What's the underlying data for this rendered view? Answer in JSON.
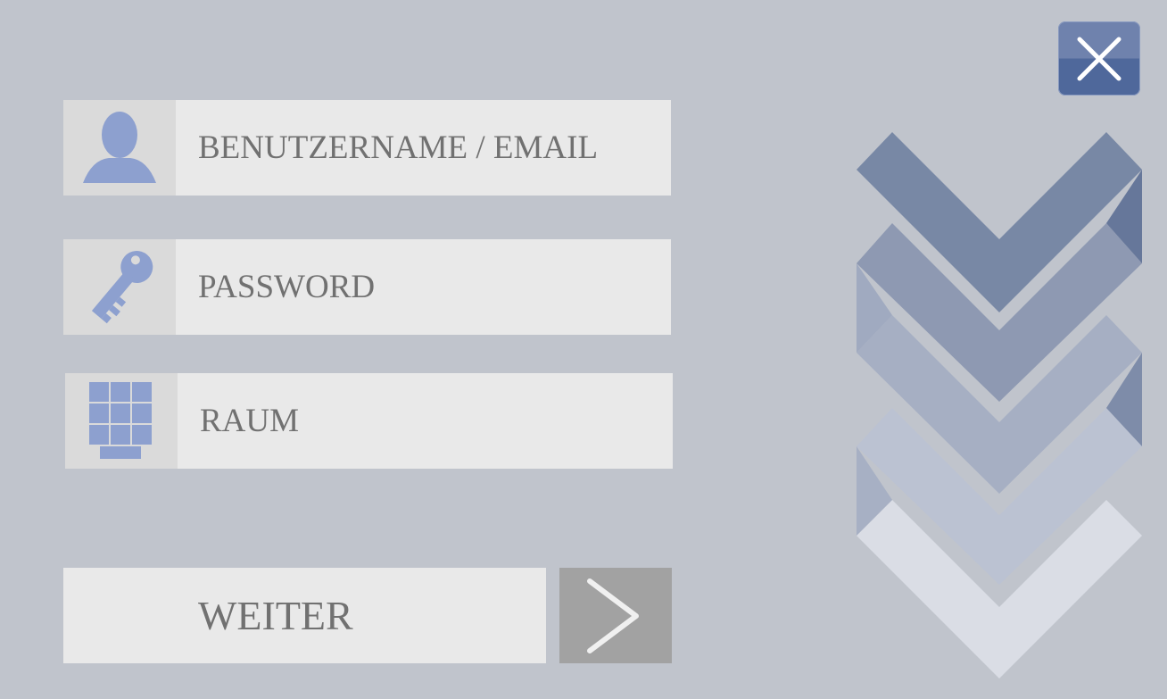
{
  "login_form": {
    "username_label": "BENUTZERNAME / EMAIL",
    "password_label": "PASSWORD",
    "room_label": "RAUM",
    "submit_label": "WEITER"
  },
  "icons": {
    "username": "user-icon",
    "password": "key-icon",
    "room": "keypad-icon",
    "submit": "chevron-right-icon",
    "close": "close-icon",
    "decoration": "chevron-stack-logo"
  },
  "colors": {
    "background": "#c0c4cc",
    "field": "#e9e9e9",
    "icon_cell": "#dadada",
    "icon_blue": "#8da0cf",
    "text": "#717171",
    "go_button": "#a2a2a2",
    "close_button": "#5a71a4"
  }
}
